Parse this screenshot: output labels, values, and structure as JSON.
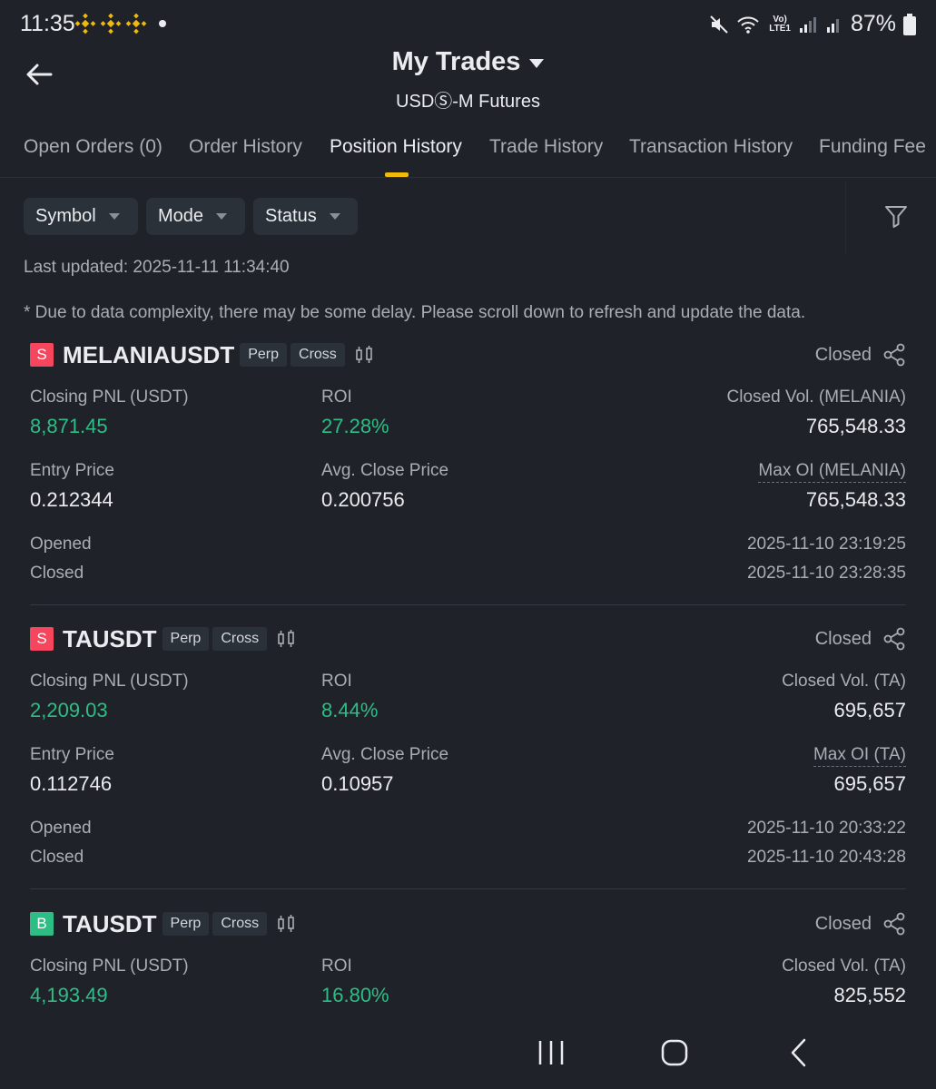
{
  "status_bar": {
    "time": "11:35",
    "battery": "87%",
    "network": "LTE1"
  },
  "header": {
    "title": "My Trades",
    "subtitle": "USDⓈ-M Futures"
  },
  "tabs": [
    {
      "label": "Open Orders (0)",
      "active": false
    },
    {
      "label": "Order History",
      "active": false
    },
    {
      "label": "Position History",
      "active": true
    },
    {
      "label": "Trade History",
      "active": false
    },
    {
      "label": "Transaction History",
      "active": false
    },
    {
      "label": "Funding Fee",
      "active": false
    }
  ],
  "filters": {
    "symbol": "Symbol",
    "mode": "Mode",
    "status": "Status"
  },
  "last_updated": "Last updated: 2025-11-11 11:34:40",
  "notice": "* Due to data complexity, there may be some delay. Please scroll down to refresh and update the data.",
  "positions": [
    {
      "side": "S",
      "symbol": "MELANIAUSDT",
      "tag1": "Perp",
      "tag2": "Cross",
      "status": "Closed",
      "pnl_label": "Closing PNL (USDT)",
      "pnl": "8,871.45",
      "roi_label": "ROI",
      "roi": "27.28%",
      "vol_label": "Closed Vol. (MELANIA)",
      "vol": "765,548.33",
      "entry_label": "Entry Price",
      "entry": "0.212344",
      "avg_label": "Avg. Close Price",
      "avg": "0.200756",
      "maxoi_label": "Max OI (MELANIA)",
      "maxoi": "765,548.33",
      "opened_label": "Opened",
      "opened": "2025-11-10 23:19:25",
      "closed_label": "Closed",
      "closed": "2025-11-10 23:28:35"
    },
    {
      "side": "S",
      "symbol": "TAUSDT",
      "tag1": "Perp",
      "tag2": "Cross",
      "status": "Closed",
      "pnl_label": "Closing PNL (USDT)",
      "pnl": "2,209.03",
      "roi_label": "ROI",
      "roi": "8.44%",
      "vol_label": "Closed Vol. (TA)",
      "vol": "695,657",
      "entry_label": "Entry Price",
      "entry": "0.112746",
      "avg_label": "Avg. Close Price",
      "avg": "0.10957",
      "maxoi_label": "Max OI (TA)",
      "maxoi": "695,657",
      "opened_label": "Opened",
      "opened": "2025-11-10 20:33:22",
      "closed_label": "Closed",
      "closed": "2025-11-10 20:43:28"
    },
    {
      "side": "B",
      "symbol": "TAUSDT",
      "tag1": "Perp",
      "tag2": "Cross",
      "status": "Closed",
      "pnl_label": "Closing PNL (USDT)",
      "pnl": "4,193.49",
      "roi_label": "ROI",
      "roi": "16.80%",
      "vol_label": "Closed Vol. (TA)",
      "vol": "825,552"
    }
  ],
  "colors": {
    "background": "#1f2329",
    "accent": "#f0b90b",
    "profit": "#2ebd85",
    "sell": "#f6465d",
    "buy": "#2ebd85"
  }
}
